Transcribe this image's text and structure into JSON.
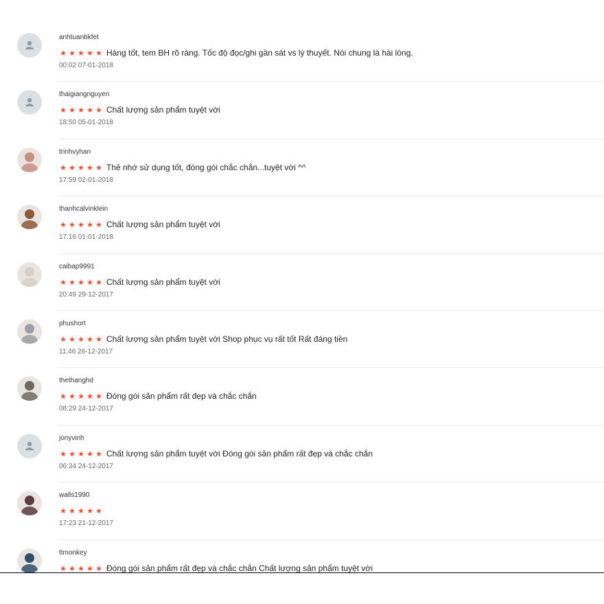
{
  "reviews": [
    {
      "username": "anhtuanbkfet",
      "rating": 5,
      "comment": "Hàng tốt, tem BH rõ ràng. Tốc độ đọc/ghi gần sát vs lý thuyết. Nói chung là hài lòng.",
      "time": "00:02 07-01-2018",
      "avatar": "default-avatar-icon"
    },
    {
      "username": "thaigiangnguyen",
      "rating": 5,
      "comment": "Chất lượng sản phẩm tuyệt vời",
      "time": "18:50 05-01-2018",
      "avatar": "default-avatar-icon"
    },
    {
      "username": "trinhvyhan",
      "rating": 5,
      "comment": "Thẻ nhớ sử dụng tốt, đóng gói chắc chắn...tuyệt vời ^^",
      "time": "17:59 02-01-2018",
      "avatar": "photo-avatar"
    },
    {
      "username": "thanhcalvinklein",
      "rating": 5,
      "comment": "Chất lượng sản phẩm tuyệt vời",
      "time": "17:16 01-01-2018",
      "avatar": "photo-avatar"
    },
    {
      "username": "caibap9991",
      "rating": 5,
      "comment": "Chất lượng sản phẩm tuyệt vời",
      "time": "20:49 29-12-2017",
      "avatar": "photo-avatar"
    },
    {
      "username": "phushort",
      "rating": 5,
      "comment": "Chất lượng sản phẩm tuyệt vời Shop phục vụ rất tốt Rất đáng tiền",
      "time": "11:46 26-12-2017",
      "avatar": "photo-avatar"
    },
    {
      "username": "thethanghd",
      "rating": 5,
      "comment": "Đóng gói sản phẩm rất đẹp và chắc chắn",
      "time": "08:29 24-12-2017",
      "avatar": "photo-avatar"
    },
    {
      "username": "jonyvinh",
      "rating": 5,
      "comment": "Chất lượng sản phẩm tuyệt vời Đóng gói sản phẩm rất đẹp và chắc chắn",
      "time": "06:34 24-12-2017",
      "avatar": "default-avatar-icon"
    },
    {
      "username": "walls1990",
      "rating": 5,
      "comment": "",
      "time": "17:23 21-12-2017",
      "avatar": "photo-avatar"
    },
    {
      "username": "ttmonkey",
      "rating": 5,
      "comment": "Đóng gói sản phẩm rất đẹp và chắc chắn Chất lượng sản phẩm tuyệt vời",
      "time": "",
      "avatar": "photo-avatar"
    }
  ],
  "colors": {
    "star": "#ee4d2d",
    "default_avatar_bg": "#dbe0e5",
    "default_avatar_fg": "#8f9aa5",
    "photo_avatars": [
      "#c98f80",
      "#8a5a3a",
      "#d7cfc9",
      "#9aa0a5",
      "#6e6a66",
      "#5b3b45",
      "#2f4f6b"
    ]
  },
  "icons": {
    "star": "★"
  }
}
